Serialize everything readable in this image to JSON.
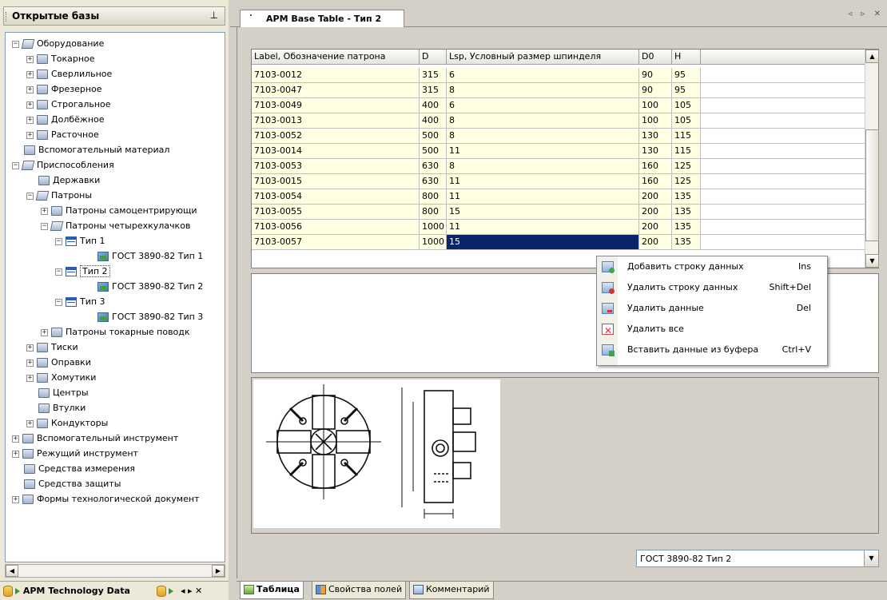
{
  "left_panel": {
    "title": "Открытые базы",
    "pin_icon": "pin-icon",
    "tree": [
      {
        "label": "Оборудование",
        "level": 0,
        "expander": "−",
        "icon": "folder-open"
      },
      {
        "label": "Токарное",
        "level": 1,
        "expander": "+",
        "icon": "folder"
      },
      {
        "label": "Сверлильное",
        "level": 1,
        "expander": "+",
        "icon": "folder"
      },
      {
        "label": "Фрезерное",
        "level": 1,
        "expander": "+",
        "icon": "folder"
      },
      {
        "label": "Строгальное",
        "level": 1,
        "expander": "+",
        "icon": "folder"
      },
      {
        "label": "Долбёжное",
        "level": 1,
        "expander": "+",
        "icon": "folder"
      },
      {
        "label": "Расточное",
        "level": 1,
        "expander": "+",
        "icon": "folder"
      },
      {
        "label": "Вспомогательный материал",
        "level": 0,
        "expander": "",
        "icon": "folder"
      },
      {
        "label": "Приспособления",
        "level": 0,
        "expander": "−",
        "icon": "folder-open"
      },
      {
        "label": "Державки",
        "level": 1,
        "expander": "",
        "icon": "folder"
      },
      {
        "label": "Патроны",
        "level": 1,
        "expander": "−",
        "icon": "folder-open"
      },
      {
        "label": "Патроны самоцентрирующи",
        "level": 2,
        "expander": "+",
        "icon": "folder"
      },
      {
        "label": "Патроны четырехкулачков",
        "level": 2,
        "expander": "−",
        "icon": "folder-open"
      },
      {
        "label": "Тип 1",
        "level": 3,
        "expander": "−",
        "icon": "table"
      },
      {
        "label": "ГОСТ 3890-82 Тип 1",
        "level": 4,
        "expander": "",
        "icon": "img"
      },
      {
        "label": "Тип 2",
        "level": 3,
        "expander": "−",
        "icon": "table",
        "selected": true
      },
      {
        "label": "ГОСТ 3890-82 Тип 2",
        "level": 4,
        "expander": "",
        "icon": "img"
      },
      {
        "label": "Тип 3",
        "level": 3,
        "expander": "−",
        "icon": "table"
      },
      {
        "label": "ГОСТ 3890-82 Тип 3",
        "level": 4,
        "expander": "",
        "icon": "img"
      },
      {
        "label": "Патроны  токарные поводк",
        "level": 2,
        "expander": "+",
        "icon": "folder"
      },
      {
        "label": "Тиски",
        "level": 1,
        "expander": "+",
        "icon": "folder"
      },
      {
        "label": "Оправки",
        "level": 1,
        "expander": "+",
        "icon": "folder"
      },
      {
        "label": "Хомутики",
        "level": 1,
        "expander": "+",
        "icon": "folder"
      },
      {
        "label": "Центры",
        "level": 1,
        "expander": "",
        "icon": "folder"
      },
      {
        "label": "Втулки",
        "level": 1,
        "expander": "",
        "icon": "folder"
      },
      {
        "label": "Кондукторы",
        "level": 1,
        "expander": "+",
        "icon": "folder"
      },
      {
        "label": "Вспомогательный инструмент",
        "level": 0,
        "expander": "+",
        "icon": "folder"
      },
      {
        "label": "Режущий инструмент",
        "level": 0,
        "expander": "+",
        "icon": "folder"
      },
      {
        "label": "Средства измерения",
        "level": 0,
        "expander": "",
        "icon": "folder"
      },
      {
        "label": "Средства защиты",
        "level": 0,
        "expander": "",
        "icon": "folder"
      },
      {
        "label": "Формы технологической документ",
        "level": 0,
        "expander": "+",
        "icon": "folder"
      }
    ],
    "bottom_tab": "APM Technology Data",
    "bottom_tab_nav": "◂ ▸ ✕"
  },
  "document": {
    "tab_title": "APM Base Table - Тип 2",
    "tab_nav": "◃ ▹ ✕"
  },
  "grid": {
    "columns": [
      "Label, Обозначение патрона",
      "D",
      "Lsp, Условный размер шпинделя",
      "D0",
      "H"
    ],
    "rows": [
      [
        "7103-0012",
        "315",
        "6",
        "90",
        "95"
      ],
      [
        "7103-0047",
        "315",
        "8",
        "90",
        "95"
      ],
      [
        "7103-0049",
        "400",
        "6",
        "100",
        "105"
      ],
      [
        "7103-0013",
        "400",
        "8",
        "100",
        "105"
      ],
      [
        "7103-0052",
        "500",
        "8",
        "130",
        "115"
      ],
      [
        "7103-0014",
        "500",
        "11",
        "130",
        "115"
      ],
      [
        "7103-0053",
        "630",
        "8",
        "160",
        "125"
      ],
      [
        "7103-0015",
        "630",
        "11",
        "160",
        "125"
      ],
      [
        "7103-0054",
        "800",
        "11",
        "200",
        "135"
      ],
      [
        "7103-0055",
        "800",
        "15",
        "200",
        "135"
      ],
      [
        "7103-0056",
        "1000",
        "11",
        "200",
        "135"
      ],
      [
        "7103-0057",
        "1000",
        "15",
        "200",
        "135"
      ]
    ]
  },
  "context_menu": [
    {
      "label": "Добавить строку данных",
      "shortcut": "Ins",
      "icon": "add-row-icon"
    },
    {
      "label": "Удалить строку данных",
      "shortcut": "Shift+Del",
      "icon": "delete-row-icon"
    },
    {
      "label": "Удалить данные",
      "shortcut": "Del",
      "icon": "clear-data-icon"
    },
    {
      "label": "Удалить все",
      "shortcut": "",
      "icon": "delete-all-icon"
    },
    {
      "label": "Вставить данные из буфера",
      "shortcut": "Ctrl+V",
      "icon": "paste-icon"
    }
  ],
  "image_selector": {
    "value": "ГОСТ 3890-82 Тип 2"
  },
  "bottom_tabs": [
    "Таблица",
    "Свойства полей",
    "Комментарий"
  ],
  "colors": {
    "selection": "#0a246a",
    "data_cell": "#ffffe1",
    "accent": "#2c5bb5"
  }
}
